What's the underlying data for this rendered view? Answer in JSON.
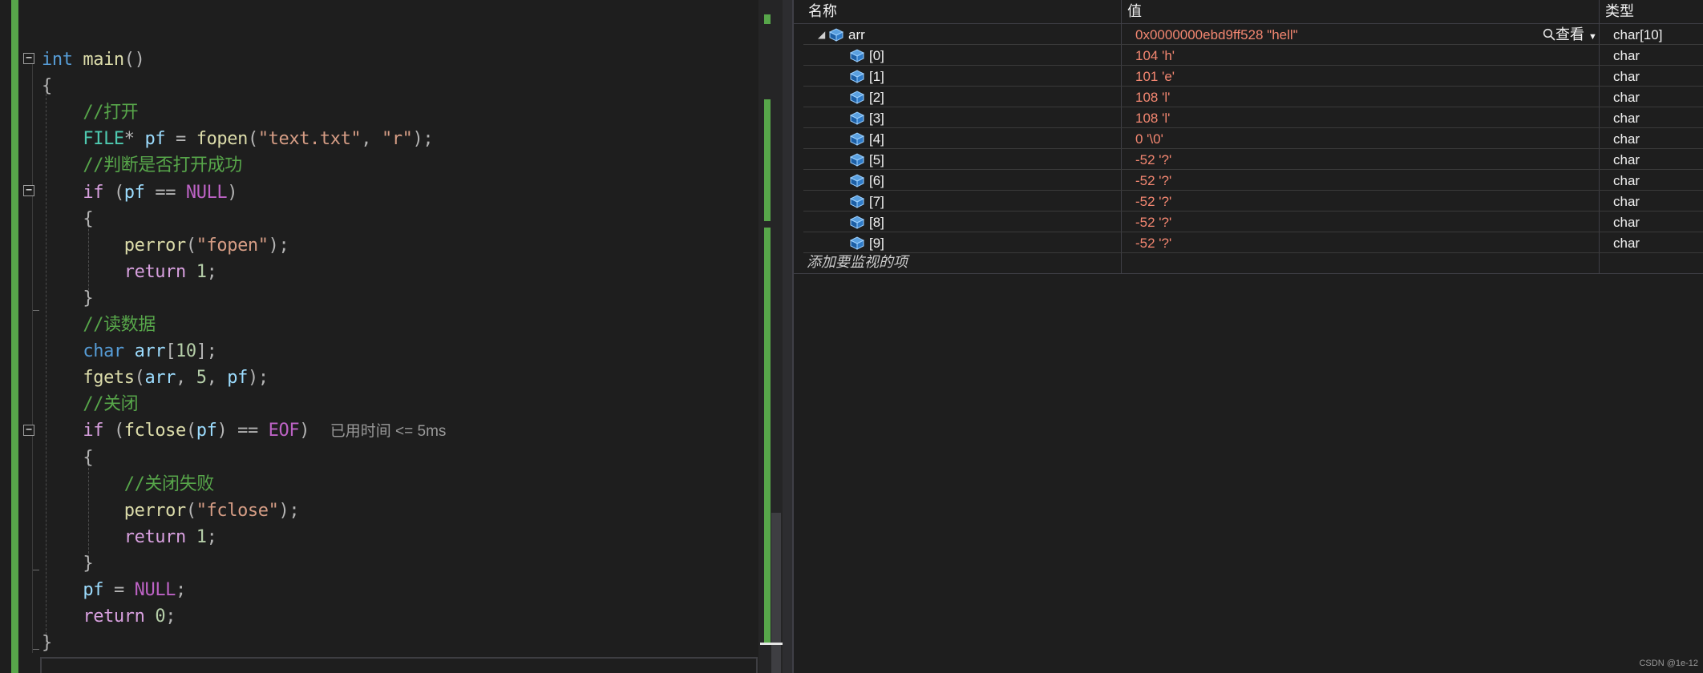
{
  "editor": {
    "lines": [
      {
        "tokens": [
          {
            "t": "int",
            "c": "kw"
          },
          {
            "t": " main",
            "c": "fn"
          },
          {
            "t": "()",
            "c": "pun"
          }
        ]
      },
      {
        "tokens": [
          {
            "t": "{",
            "c": "pun"
          }
        ]
      },
      {
        "tokens": [
          {
            "t": "    //打开",
            "c": "cm"
          }
        ]
      },
      {
        "tokens": [
          {
            "t": "    "
          },
          {
            "t": "FILE",
            "c": "ty"
          },
          {
            "t": "* ",
            "c": "pun"
          },
          {
            "t": "pf",
            "c": "var"
          },
          {
            "t": " = ",
            "c": "pun"
          },
          {
            "t": "fopen",
            "c": "fn"
          },
          {
            "t": "(",
            "c": "pun"
          },
          {
            "t": "\"text.txt\"",
            "c": "str"
          },
          {
            "t": ", ",
            "c": "pun"
          },
          {
            "t": "\"r\"",
            "c": "str"
          },
          {
            "t": ");",
            "c": "pun"
          }
        ]
      },
      {
        "tokens": [
          {
            "t": "    //判断是否打开成功",
            "c": "cm"
          }
        ]
      },
      {
        "tokens": [
          {
            "t": "    "
          },
          {
            "t": "if",
            "c": "kw2"
          },
          {
            "t": " (",
            "c": "pun"
          },
          {
            "t": "pf",
            "c": "var"
          },
          {
            "t": " == ",
            "c": "pun"
          },
          {
            "t": "NULL",
            "c": "mac"
          },
          {
            "t": ")",
            "c": "pun"
          }
        ]
      },
      {
        "tokens": [
          {
            "t": "    {",
            "c": "pun"
          }
        ]
      },
      {
        "tokens": [
          {
            "t": "        "
          },
          {
            "t": "perror",
            "c": "fn"
          },
          {
            "t": "(",
            "c": "pun"
          },
          {
            "t": "\"fopen\"",
            "c": "str"
          },
          {
            "t": ");",
            "c": "pun"
          }
        ]
      },
      {
        "tokens": [
          {
            "t": "        "
          },
          {
            "t": "return",
            "c": "kw2"
          },
          {
            "t": " "
          },
          {
            "t": "1",
            "c": "num"
          },
          {
            "t": ";",
            "c": "pun"
          }
        ]
      },
      {
        "tokens": [
          {
            "t": "    }",
            "c": "pun"
          }
        ]
      },
      {
        "tokens": [
          {
            "t": "    //读数据",
            "c": "cm"
          }
        ]
      },
      {
        "tokens": [
          {
            "t": "    "
          },
          {
            "t": "char",
            "c": "kw"
          },
          {
            "t": " "
          },
          {
            "t": "arr",
            "c": "var"
          },
          {
            "t": "[",
            "c": "pun"
          },
          {
            "t": "10",
            "c": "num"
          },
          {
            "t": "];",
            "c": "pun"
          }
        ]
      },
      {
        "tokens": [
          {
            "t": "    "
          },
          {
            "t": "fgets",
            "c": "fn"
          },
          {
            "t": "(",
            "c": "pun"
          },
          {
            "t": "arr",
            "c": "var"
          },
          {
            "t": ", ",
            "c": "pun"
          },
          {
            "t": "5",
            "c": "num"
          },
          {
            "t": ", ",
            "c": "pun"
          },
          {
            "t": "pf",
            "c": "var"
          },
          {
            "t": ");",
            "c": "pun"
          }
        ]
      },
      {
        "tokens": [
          {
            "t": "    //关闭",
            "c": "cm"
          }
        ]
      },
      {
        "tokens": [
          {
            "t": "    "
          },
          {
            "t": "if",
            "c": "kw2"
          },
          {
            "t": " (",
            "c": "pun"
          },
          {
            "t": "fclose",
            "c": "fn"
          },
          {
            "t": "(",
            "c": "pun"
          },
          {
            "t": "pf",
            "c": "var"
          },
          {
            "t": ") == ",
            "c": "pun"
          },
          {
            "t": "EOF",
            "c": "mac"
          },
          {
            "t": ")",
            "c": "pun"
          },
          {
            "t": "  "
          },
          {
            "t": "已用时间 <= 5ms",
            "c": "hint"
          }
        ]
      },
      {
        "tokens": [
          {
            "t": "    {",
            "c": "pun"
          }
        ]
      },
      {
        "tokens": [
          {
            "t": "        //关闭失败",
            "c": "cm"
          }
        ]
      },
      {
        "tokens": [
          {
            "t": "        "
          },
          {
            "t": "perror",
            "c": "fn"
          },
          {
            "t": "(",
            "c": "pun"
          },
          {
            "t": "\"fclose\"",
            "c": "str"
          },
          {
            "t": ");",
            "c": "pun"
          }
        ]
      },
      {
        "tokens": [
          {
            "t": "        "
          },
          {
            "t": "return",
            "c": "kw2"
          },
          {
            "t": " "
          },
          {
            "t": "1",
            "c": "num"
          },
          {
            "t": ";",
            "c": "pun"
          }
        ]
      },
      {
        "tokens": [
          {
            "t": "    }",
            "c": "pun"
          }
        ]
      },
      {
        "tokens": [
          {
            "t": "    "
          },
          {
            "t": "pf",
            "c": "var"
          },
          {
            "t": " = ",
            "c": "pun"
          },
          {
            "t": "NULL",
            "c": "mac"
          },
          {
            "t": ";",
            "c": "pun"
          }
        ]
      },
      {
        "tokens": [
          {
            "t": "    "
          },
          {
            "t": "return",
            "c": "kw2"
          },
          {
            "t": " "
          },
          {
            "t": "0",
            "c": "num"
          },
          {
            "t": ";",
            "c": "pun"
          }
        ]
      },
      {
        "tokens": [
          {
            "t": "}",
            "c": "pun"
          }
        ]
      }
    ]
  },
  "watch": {
    "headers": {
      "name": "名称",
      "value": "值",
      "type": "类型"
    },
    "root": {
      "name": "arr",
      "value": "0x0000000ebd9ff528 \"hell\"",
      "type": "char[10]",
      "view_label": "查看"
    },
    "items": [
      {
        "name": "[0]",
        "value": "104 'h'",
        "type": "char"
      },
      {
        "name": "[1]",
        "value": "101 'e'",
        "type": "char"
      },
      {
        "name": "[2]",
        "value": "108 'l'",
        "type": "char"
      },
      {
        "name": "[3]",
        "value": "108 'l'",
        "type": "char"
      },
      {
        "name": "[4]",
        "value": "0 '\\0'",
        "type": "char"
      },
      {
        "name": "[5]",
        "value": "-52 '?'",
        "type": "char"
      },
      {
        "name": "[6]",
        "value": "-52 '?'",
        "type": "char"
      },
      {
        "name": "[7]",
        "value": "-52 '?'",
        "type": "char"
      },
      {
        "name": "[8]",
        "value": "-52 '?'",
        "type": "char"
      },
      {
        "name": "[9]",
        "value": "-52 '?'",
        "type": "char"
      }
    ],
    "add_watch_label": "添加要监视的项"
  },
  "watermark": "CSDN @1e-12"
}
